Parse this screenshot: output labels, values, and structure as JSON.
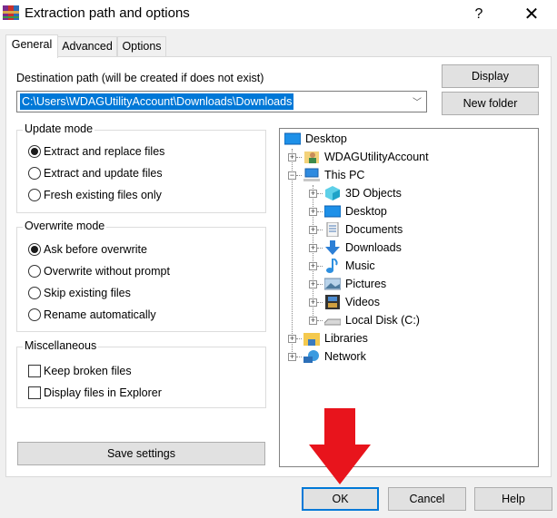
{
  "window": {
    "title": "Extraction path and options",
    "help_label": "?",
    "close_label": "✕"
  },
  "tabs": [
    {
      "label": "General",
      "active": true
    },
    {
      "label": "Advanced",
      "active": false
    },
    {
      "label": "Options",
      "active": false
    }
  ],
  "destination": {
    "label": "Destination path (will be created if does not exist)",
    "value": "C:\\Users\\WDAGUtilityAccount\\Downloads\\Downloads",
    "dropdown_icon": "﹀"
  },
  "buttons": {
    "display": "Display",
    "new_folder": "New folder",
    "save_settings": "Save settings",
    "ok": "OK",
    "cancel": "Cancel",
    "help": "Help"
  },
  "update_mode": {
    "title": "Update mode",
    "options": [
      {
        "label": "Extract and replace files",
        "selected": true
      },
      {
        "label": "Extract and update files",
        "selected": false
      },
      {
        "label": "Fresh existing files only",
        "selected": false
      }
    ]
  },
  "overwrite_mode": {
    "title": "Overwrite mode",
    "options": [
      {
        "label": "Ask before overwrite",
        "selected": true
      },
      {
        "label": "Overwrite without prompt",
        "selected": false
      },
      {
        "label": "Skip existing files",
        "selected": false
      },
      {
        "label": "Rename automatically",
        "selected": false
      }
    ]
  },
  "miscellaneous": {
    "title": "Miscellaneous",
    "options": [
      {
        "label": "Keep broken files",
        "checked": false
      },
      {
        "label": "Display files in Explorer",
        "checked": false
      }
    ]
  },
  "folder_tree": [
    {
      "label": "Desktop",
      "icon": "desktop-icon",
      "expander": ""
    },
    {
      "label": "WDAGUtilityAccount",
      "icon": "user-folder-icon",
      "expander": "+"
    },
    {
      "label": "This PC",
      "icon": "computer-icon",
      "expander": "−"
    },
    {
      "label": "3D Objects",
      "icon": "3d-objects-icon",
      "expander": "+"
    },
    {
      "label": "Desktop",
      "icon": "desktop-icon",
      "expander": "+"
    },
    {
      "label": "Documents",
      "icon": "documents-icon",
      "expander": "+"
    },
    {
      "label": "Downloads",
      "icon": "downloads-icon",
      "expander": "+"
    },
    {
      "label": "Music",
      "icon": "music-icon",
      "expander": "+"
    },
    {
      "label": "Pictures",
      "icon": "pictures-icon",
      "expander": "+"
    },
    {
      "label": "Videos",
      "icon": "videos-icon",
      "expander": "+"
    },
    {
      "label": "Local Disk (C:)",
      "icon": "drive-icon",
      "expander": "+"
    },
    {
      "label": "Libraries",
      "icon": "libraries-icon",
      "expander": "+"
    },
    {
      "label": "Network",
      "icon": "network-icon",
      "expander": "+"
    }
  ],
  "annotation": {
    "color": "#e8141c"
  },
  "colors": {
    "accent": "#0078d7",
    "selection_text": "#ffffff"
  }
}
